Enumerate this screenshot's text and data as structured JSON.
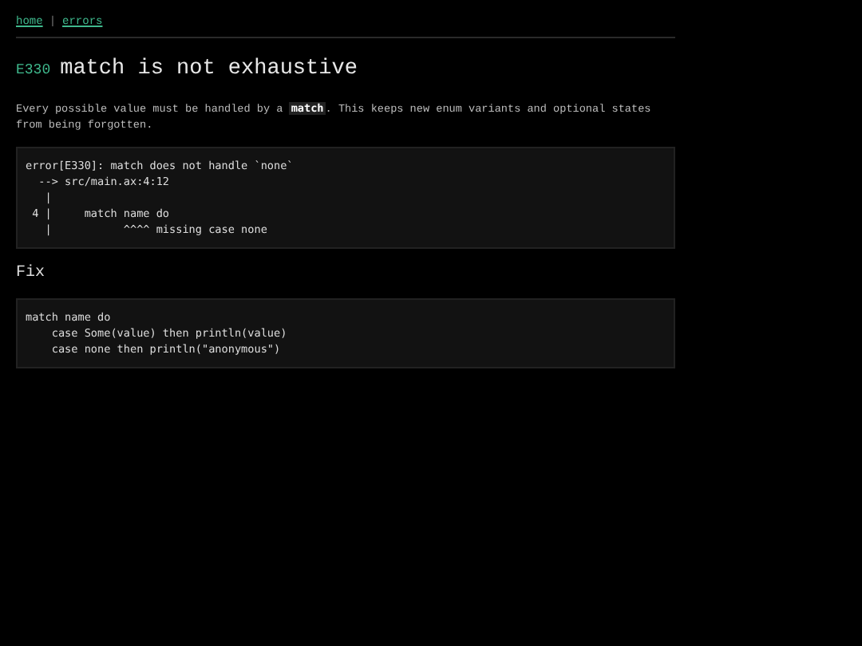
{
  "breadcrumbs": [
    {
      "label": "home"
    },
    {
      "label": "errors"
    }
  ],
  "breadcrumb_separator": "|",
  "heading": {
    "code": "E330",
    "title": "match is not exhaustive"
  },
  "description": [
    {
      "kind": "text",
      "text": "Every possible value must be handled by a "
    },
    {
      "kind": "code",
      "text": "match"
    },
    {
      "kind": "text",
      "text": ". This keeps new enum variants and optional states from being forgotten."
    }
  ],
  "error_output": [
    "error[E330]: match does not handle `none`",
    "  --> src/main.ax:4:12",
    "   |",
    " 4 |     match name do",
    "   |           ^^^^ missing case none"
  ],
  "fix": {
    "heading": "Fix",
    "code": [
      "match name do",
      "    case Some(value) then println(value)",
      "    case none then println(\"anonymous\")"
    ]
  }
}
